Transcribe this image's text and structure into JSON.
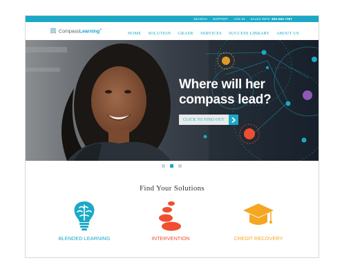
{
  "topbar": {
    "search": "SEARCH",
    "support": "SUPPORT",
    "login": "LOG IN",
    "sales_label": "SALES INFO:",
    "sales_phone": "866-584-7387"
  },
  "logo": {
    "text_a": "Compass",
    "text_b": "Learning",
    "mark": "®"
  },
  "nav": {
    "items": [
      "HOME",
      "SOLUTION",
      "GRADE",
      "SERVICES",
      "SUCCESS LIBRARY",
      "ABOUT US"
    ]
  },
  "hero": {
    "headline_line1": "Where will her",
    "headline_line2": "compass lead?",
    "cta_label": "CLICK TO FIND OUT",
    "cta_icon": "chevron-right-icon"
  },
  "carousel": {
    "slide_count": 3,
    "active_index": 1
  },
  "solutions": {
    "title": "Find Your Solutions",
    "items": [
      {
        "label": "BLENDED LEARNING",
        "icon": "brain-bulb-icon",
        "color": "#1ba9c6"
      },
      {
        "label": "INTERVENTION",
        "icon": "stacked-stones-icon",
        "color": "#f04e30"
      },
      {
        "label": "CREDIT RECOVERY",
        "icon": "graduation-cap-icon",
        "color": "#f5a623"
      }
    ]
  },
  "colors": {
    "accent": "#1ba9c6",
    "hero_dark": "#1a2330",
    "intervention": "#f04e30",
    "credit": "#f5a623"
  }
}
